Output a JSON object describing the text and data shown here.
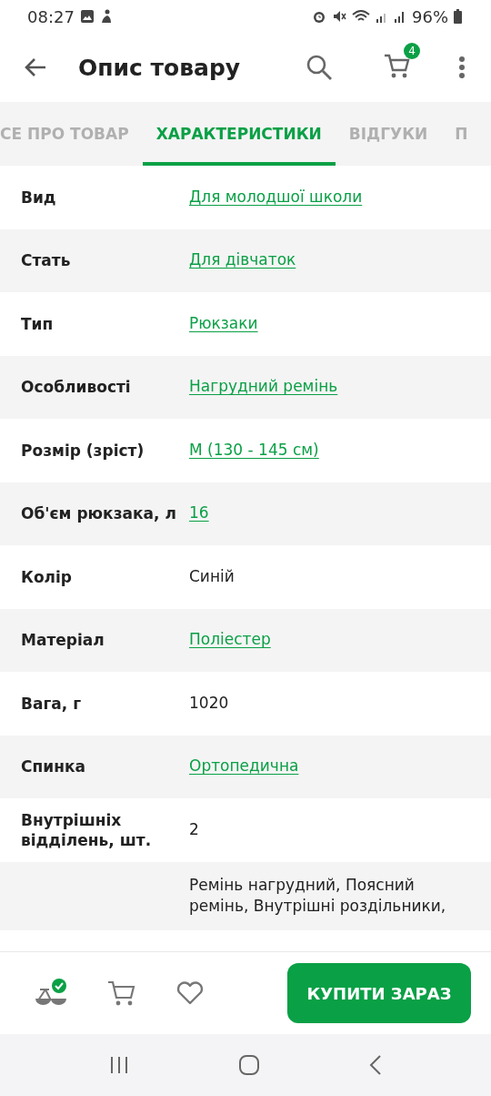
{
  "status_bar": {
    "time": "08:27",
    "battery": "96%"
  },
  "header": {
    "title": "Опис товару",
    "cart_count": "4"
  },
  "tabs": [
    {
      "label": "СЕ ПРО ТОВАР",
      "selected": false
    },
    {
      "label": "ХАРАКТЕРИСТИКИ",
      "selected": true
    },
    {
      "label": "ВІДГУКИ",
      "selected": false
    },
    {
      "label": "П",
      "selected": false
    }
  ],
  "specs": [
    {
      "label": "Вид",
      "value": "Для молодшої школи",
      "link": true
    },
    {
      "label": "Стать",
      "value": "Для дівчаток",
      "link": true
    },
    {
      "label": "Тип",
      "value": "Рюкзаки",
      "link": true
    },
    {
      "label": "Особливості",
      "value": "Нагрудний ремінь",
      "link": true
    },
    {
      "label": "Розмір (зріст)",
      "value": "M (130 - 145 см)",
      "link": true
    },
    {
      "label": "Об'єм рюкзака, л",
      "value": "16",
      "link": true
    },
    {
      "label": "Колір",
      "value": "Синій",
      "link": false
    },
    {
      "label": "Матеріал",
      "value": "Поліестер",
      "link": true
    },
    {
      "label": "Вага, г",
      "value": "1020",
      "link": false
    },
    {
      "label": "Спинка",
      "value": "Ортопедична",
      "link": true
    },
    {
      "label": "Внутрішніх відділень, шт.",
      "value": "2",
      "link": false
    },
    {
      "value": "Ремінь нагрудний, Поясний ремінь, Внутрішні роздільники,",
      "link": false
    }
  ],
  "bottom_bar": {
    "buy_button": "КУПИТИ ЗАРАЗ"
  }
}
